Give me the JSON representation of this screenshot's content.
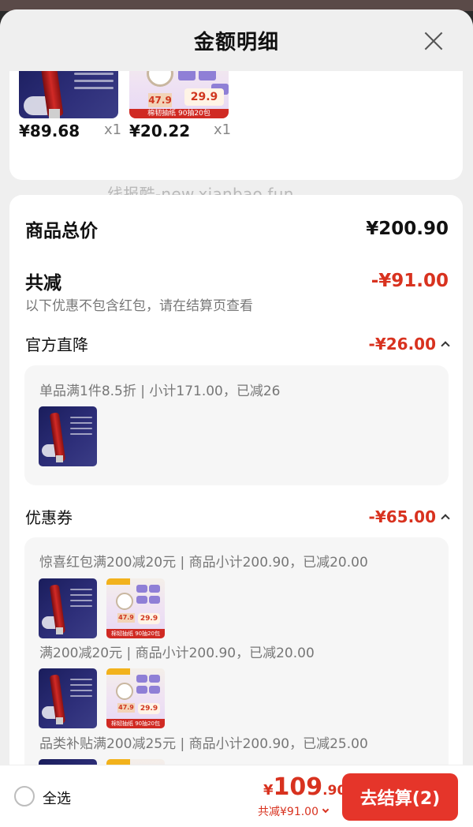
{
  "sheet": {
    "title": "金额明细"
  },
  "products": [
    {
      "price": "¥89.68",
      "qty": "x1",
      "image": "cleanser-product-image"
    },
    {
      "price": "¥20.22",
      "qty": "x1",
      "image": "tissue-product-image"
    }
  ],
  "watermark": "线报酷-new.xianbao.fun",
  "summary": {
    "total_label": "商品总价",
    "total_value": "¥200.90",
    "discount_label": "共减",
    "discount_value": "-¥91.00",
    "note": "以下优惠不包含红包，请在结算页查看"
  },
  "official_drop": {
    "label": "官方直降",
    "value": "-¥26.00",
    "items": [
      {
        "text": "单品满1件8.5折 | 小计171.00，已减26"
      }
    ]
  },
  "coupons": {
    "label": "优惠券",
    "value": "-¥65.00",
    "items": [
      {
        "text": "惊喜红包满200减20元 | 商品小计200.90，已减20.00"
      },
      {
        "text": "满200减20元 | 商品小计200.90，已减20.00"
      },
      {
        "text": "品类补贴满200减25元 | 商品小计200.90，已减25.00"
      }
    ]
  },
  "footer": {
    "select_all": "全选",
    "currency": "¥",
    "pay_int": "109",
    "pay_dec": ".90",
    "saving": "共减¥91.00",
    "checkout": "去结算(2)"
  },
  "colors": {
    "accent_red": "#d8321f",
    "button_red": "#e5352a"
  }
}
